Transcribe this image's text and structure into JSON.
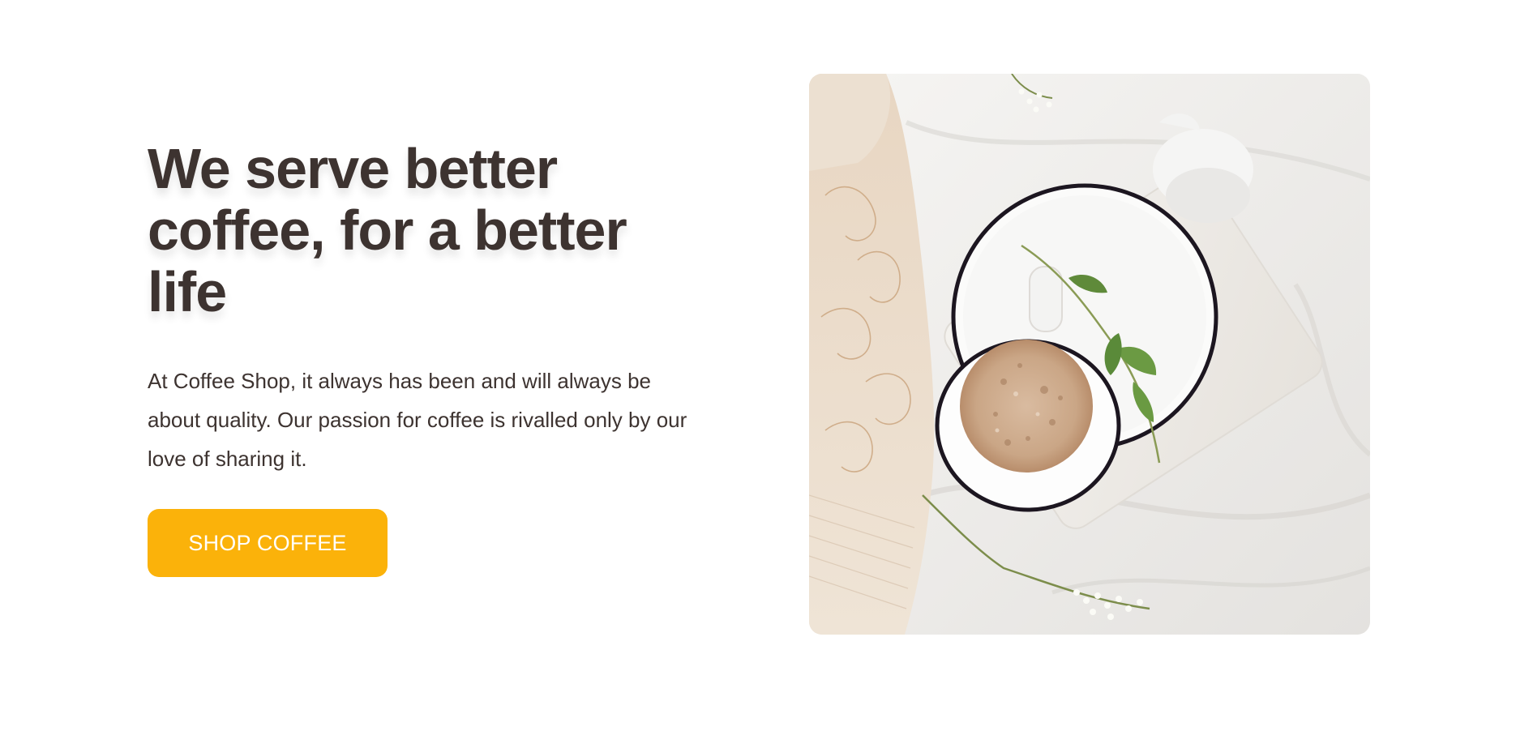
{
  "hero": {
    "headline": "We serve better coffee, for a better life",
    "body": "At Coffee Shop, it always has been and will always be about quality. Our passion for coffee is rivalled only by our love of sharing it.",
    "cta_label": "SHOP COFFEE",
    "image_alt": "Cup of latte on a marble tray with a white saucer on rumpled white linen"
  },
  "colors": {
    "heading_text": "#3d3330",
    "accent_button": "#fbb20a",
    "button_text": "#ffffff",
    "background": "#ffffff"
  }
}
